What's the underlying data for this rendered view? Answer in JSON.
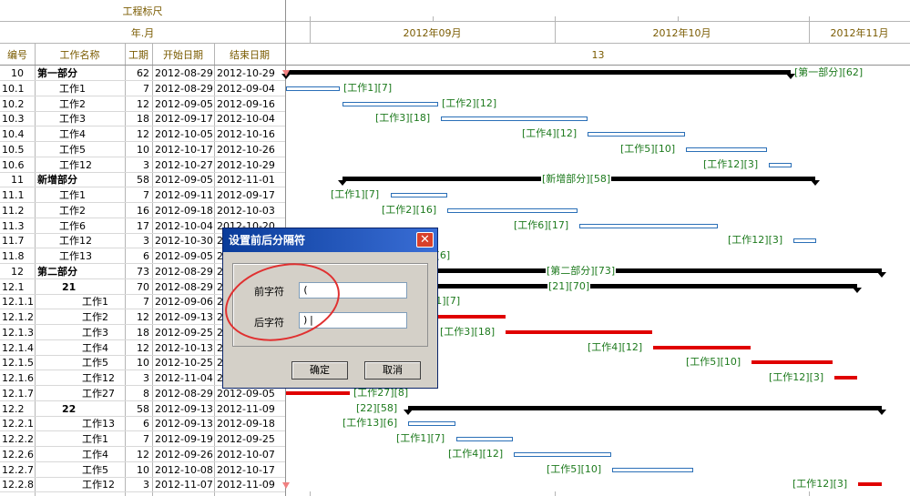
{
  "header": {
    "ruler_title": "工程标尺",
    "year_month": "年.月",
    "columns": [
      "编号",
      "工作名称",
      "工期",
      "开始日期",
      "结束日期"
    ],
    "months": [
      "2012年09月",
      "2012年10月",
      "2012年11月"
    ],
    "week_number": "13"
  },
  "rows": [
    {
      "id": "10",
      "name": "第一部分",
      "dur": "62",
      "start": "2012-08-29",
      "end": "2012-10-29",
      "type": "summary",
      "level": 0,
      "bar": [
        314,
        868
      ],
      "label": "[第一部分][62]",
      "label_side": "right"
    },
    {
      "id": "10.1",
      "name": "工作1",
      "dur": "7",
      "start": "2012-08-29",
      "end": "2012-09-04",
      "type": "task",
      "level": 1,
      "bar": [
        314,
        373
      ],
      "label": "[工作1][7]",
      "label_side": "right"
    },
    {
      "id": "10.2",
      "name": "工作2",
      "dur": "12",
      "start": "2012-09-05",
      "end": "2012-09-16",
      "type": "task",
      "level": 1,
      "bar": [
        376,
        481
      ],
      "label": "[工作2][12]",
      "label_side": "right"
    },
    {
      "id": "10.3",
      "name": "工作3",
      "dur": "18",
      "start": "2012-09-17",
      "end": "2012-10-04",
      "type": "task",
      "level": 1,
      "bar": [
        484,
        645
      ],
      "label": "[工作3][18]",
      "label_side": "left"
    },
    {
      "id": "10.4",
      "name": "工作4",
      "dur": "12",
      "start": "2012-10-05",
      "end": "2012-10-16",
      "type": "task",
      "level": 1,
      "bar": [
        645,
        752
      ],
      "label": "[工作4][12]",
      "label_side": "left"
    },
    {
      "id": "10.5",
      "name": "工作5",
      "dur": "10",
      "start": "2012-10-17",
      "end": "2012-10-26",
      "type": "task",
      "level": 1,
      "bar": [
        753,
        842
      ],
      "label": "[工作5][10]",
      "label_side": "left"
    },
    {
      "id": "10.6",
      "name": "工作12",
      "dur": "3",
      "start": "2012-10-27",
      "end": "2012-10-29",
      "type": "task",
      "level": 1,
      "bar": [
        844,
        869
      ],
      "label": "[工作12][3]",
      "label_side": "left"
    },
    {
      "id": "11",
      "name": "新增部分",
      "dur": "58",
      "start": "2012-09-05",
      "end": "2012-11-01",
      "type": "summary",
      "level": 0,
      "bar": [
        376,
        895
      ],
      "label": "[新增部分][58]",
      "label_side": "mid"
    },
    {
      "id": "11.1",
      "name": "工作1",
      "dur": "7",
      "start": "2012-09-11",
      "end": "2012-09-17",
      "type": "task",
      "level": 1,
      "bar": [
        429,
        491
      ],
      "label": "[工作1][7]",
      "label_side": "left"
    },
    {
      "id": "11.2",
      "name": "工作2",
      "dur": "16",
      "start": "2012-09-18",
      "end": "2012-10-03",
      "type": "task",
      "level": 1,
      "bar": [
        491,
        634
      ],
      "label": "[工作2][16]",
      "label_side": "left"
    },
    {
      "id": "11.3",
      "name": "工作6",
      "dur": "17",
      "start": "2012-10-04",
      "end": "2012-10-20",
      "type": "task",
      "level": 1,
      "bar": [
        636,
        788
      ],
      "label": "[工作6][17]",
      "label_side": "left"
    },
    {
      "id": "11.7",
      "name": "工作12",
      "dur": "3",
      "start": "2012-10-30",
      "end": "2012-11-01",
      "type": "task",
      "level": 1,
      "bar": [
        871,
        896
      ],
      "label": "[工作12][3]",
      "label_side": "left"
    },
    {
      "id": "11.8",
      "name": "工作13",
      "dur": "6",
      "start": "2012-09-05",
      "end": "2012-09-10",
      "type": "task",
      "level": 1,
      "bar": [
        376,
        430
      ],
      "label": "[工作13][6]",
      "label_side": "right"
    },
    {
      "id": "12",
      "name": "第二部分",
      "dur": "73",
      "start": "2012-08-29",
      "end": "2012-11-09",
      "type": "summary",
      "level": 0,
      "bar": [
        314,
        968
      ],
      "label": "[第二部分][73]",
      "label_side": "mid"
    },
    {
      "id": "12.1",
      "name": "21",
      "dur": "70",
      "start": "2012-08-29",
      "end": "2012-11-06",
      "type": "summary",
      "level": 1,
      "bar": [
        314,
        941
      ],
      "label": "[21][70]",
      "label_side": "mid"
    },
    {
      "id": "12.1.1",
      "name": "工作1",
      "dur": "7",
      "start": "2012-09-06",
      "end": "2012-09-12",
      "type": "crit",
      "level": 2,
      "bar": [
        385,
        448
      ],
      "label": "[工作1][7]",
      "label_side": "right"
    },
    {
      "id": "12.1.2",
      "name": "工作2",
      "dur": "12",
      "start": "2012-09-13",
      "end": "2012-09-24",
      "type": "crit",
      "level": 2,
      "bar": [
        448,
        555
      ],
      "label": "[工作2][12]",
      "label_side": "left"
    },
    {
      "id": "12.1.3",
      "name": "工作3",
      "dur": "18",
      "start": "2012-09-25",
      "end": "2012-10-12",
      "type": "crit",
      "level": 2,
      "bar": [
        555,
        716
      ],
      "label": "[工作3][18]",
      "label_side": "left"
    },
    {
      "id": "12.1.4",
      "name": "工作4",
      "dur": "12",
      "start": "2012-10-13",
      "end": "2012-10-24",
      "type": "crit",
      "level": 2,
      "bar": [
        717,
        824
      ],
      "label": "[工作4][12]",
      "label_side": "left"
    },
    {
      "id": "12.1.5",
      "name": "工作5",
      "dur": "10",
      "start": "2012-10-25",
      "end": "2012-11-03",
      "type": "crit",
      "level": 2,
      "bar": [
        825,
        914
      ],
      "label": "[工作5][10]",
      "label_side": "left"
    },
    {
      "id": "12.1.6",
      "name": "工作12",
      "dur": "3",
      "start": "2012-11-04",
      "end": "2012-11-06",
      "type": "crit",
      "level": 2,
      "bar": [
        916,
        941
      ],
      "label": "[工作12][3]",
      "label_side": "left"
    },
    {
      "id": "12.1.7",
      "name": "工作27",
      "dur": "8",
      "start": "2012-08-29",
      "end": "2012-09-05",
      "type": "crit",
      "level": 2,
      "bar": [
        314,
        384
      ],
      "label": "[工作27][8]",
      "label_side": "right"
    },
    {
      "id": "12.2",
      "name": "22",
      "dur": "58",
      "start": "2012-09-13",
      "end": "2012-11-09",
      "type": "summary",
      "level": 1,
      "bar": [
        448,
        968
      ],
      "label": "[22][58]",
      "label_side": "left"
    },
    {
      "id": "12.2.1",
      "name": "工作13",
      "dur": "6",
      "start": "2012-09-13",
      "end": "2012-09-18",
      "type": "task",
      "level": 2,
      "bar": [
        448,
        500
      ],
      "label": "[工作13][6]",
      "label_side": "left"
    },
    {
      "id": "12.2.2",
      "name": "工作1",
      "dur": "7",
      "start": "2012-09-19",
      "end": "2012-09-25",
      "type": "task",
      "level": 2,
      "bar": [
        501,
        563
      ],
      "label": "[工作1][7]",
      "label_side": "left"
    },
    {
      "id": "12.2.6",
      "name": "工作4",
      "dur": "12",
      "start": "2012-09-26",
      "end": "2012-10-07",
      "type": "task",
      "level": 2,
      "bar": [
        564,
        671
      ],
      "label": "[工作4][12]",
      "label_side": "left"
    },
    {
      "id": "12.2.7",
      "name": "工作5",
      "dur": "10",
      "start": "2012-10-08",
      "end": "2012-10-17",
      "type": "task",
      "level": 2,
      "bar": [
        672,
        761
      ],
      "label": "[工作5][10]",
      "label_side": "left"
    },
    {
      "id": "12.2.8",
      "name": "工作12",
      "dur": "3",
      "start": "2012-11-07",
      "end": "2012-11-09",
      "type": "crit",
      "level": 2,
      "bar": [
        942,
        968
      ],
      "label": "[工作12][3]",
      "label_side": "left"
    }
  ],
  "dialog": {
    "title": "设置前后分隔符",
    "prefix_label": "前字符",
    "prefix_value": "(",
    "suffix_label": "后字符",
    "suffix_value": ")|",
    "ok": "确定",
    "cancel": "取消",
    "close_glyph": "✕"
  },
  "colors": {
    "header_text": "#7a5b00",
    "label_green": "#1d7a1d",
    "summary_bar": "#000000",
    "task_bar_border": "#2a6fb7",
    "critical_bar": "#e00000",
    "dialog_title": "#0a3c9a",
    "annotation_circle": "#e03030"
  },
  "icons": {
    "close": "close-icon",
    "timeline_marker": "triangle-down-icon"
  }
}
